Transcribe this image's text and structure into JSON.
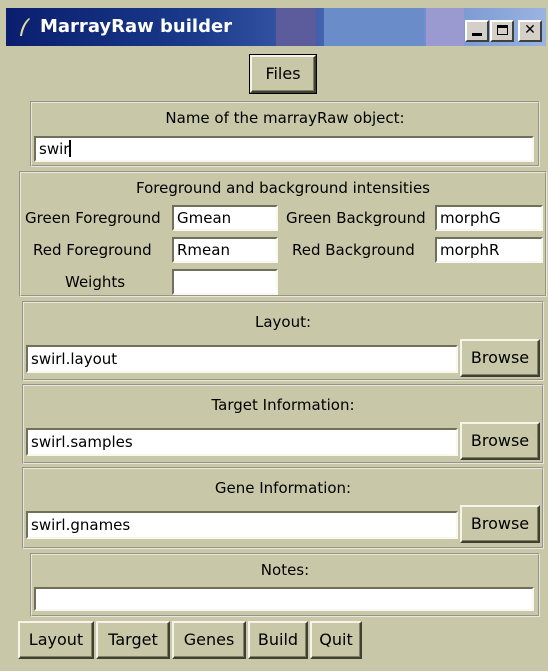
{
  "window": {
    "title": "MarrayRaw builder"
  },
  "files_button": "Files",
  "name_section": {
    "label": "Name of the marrayRaw object:",
    "value": "swir"
  },
  "intensities": {
    "heading": "Foreground and background intensities",
    "green_fg_label": "Green Foreground",
    "green_fg_value": "Gmean",
    "green_bg_label": "Green Background",
    "green_bg_value": "morphG",
    "red_fg_label": "Red Foreground",
    "red_fg_value": "Rmean",
    "red_bg_label": "Red Background",
    "red_bg_value": "morphR",
    "weights_label": "Weights",
    "weights_value": ""
  },
  "layout_section": {
    "label": "Layout:",
    "value": "swirl.layout",
    "browse": "Browse"
  },
  "target_section": {
    "label": "Target Information:",
    "value": "swirl.samples",
    "browse": "Browse"
  },
  "gene_section": {
    "label": "Gene Information:",
    "value": "swirl.gnames",
    "browse": "Browse"
  },
  "notes_section": {
    "label": "Notes:",
    "value": ""
  },
  "bottom_buttons": {
    "layout": "Layout",
    "target": "Target",
    "genes": "Genes",
    "build": "Build",
    "quit": "Quit"
  },
  "icons": {
    "app": "feather-icon",
    "minimize": "minimize-icon",
    "maximize": "maximize-icon",
    "close": "close-icon"
  }
}
